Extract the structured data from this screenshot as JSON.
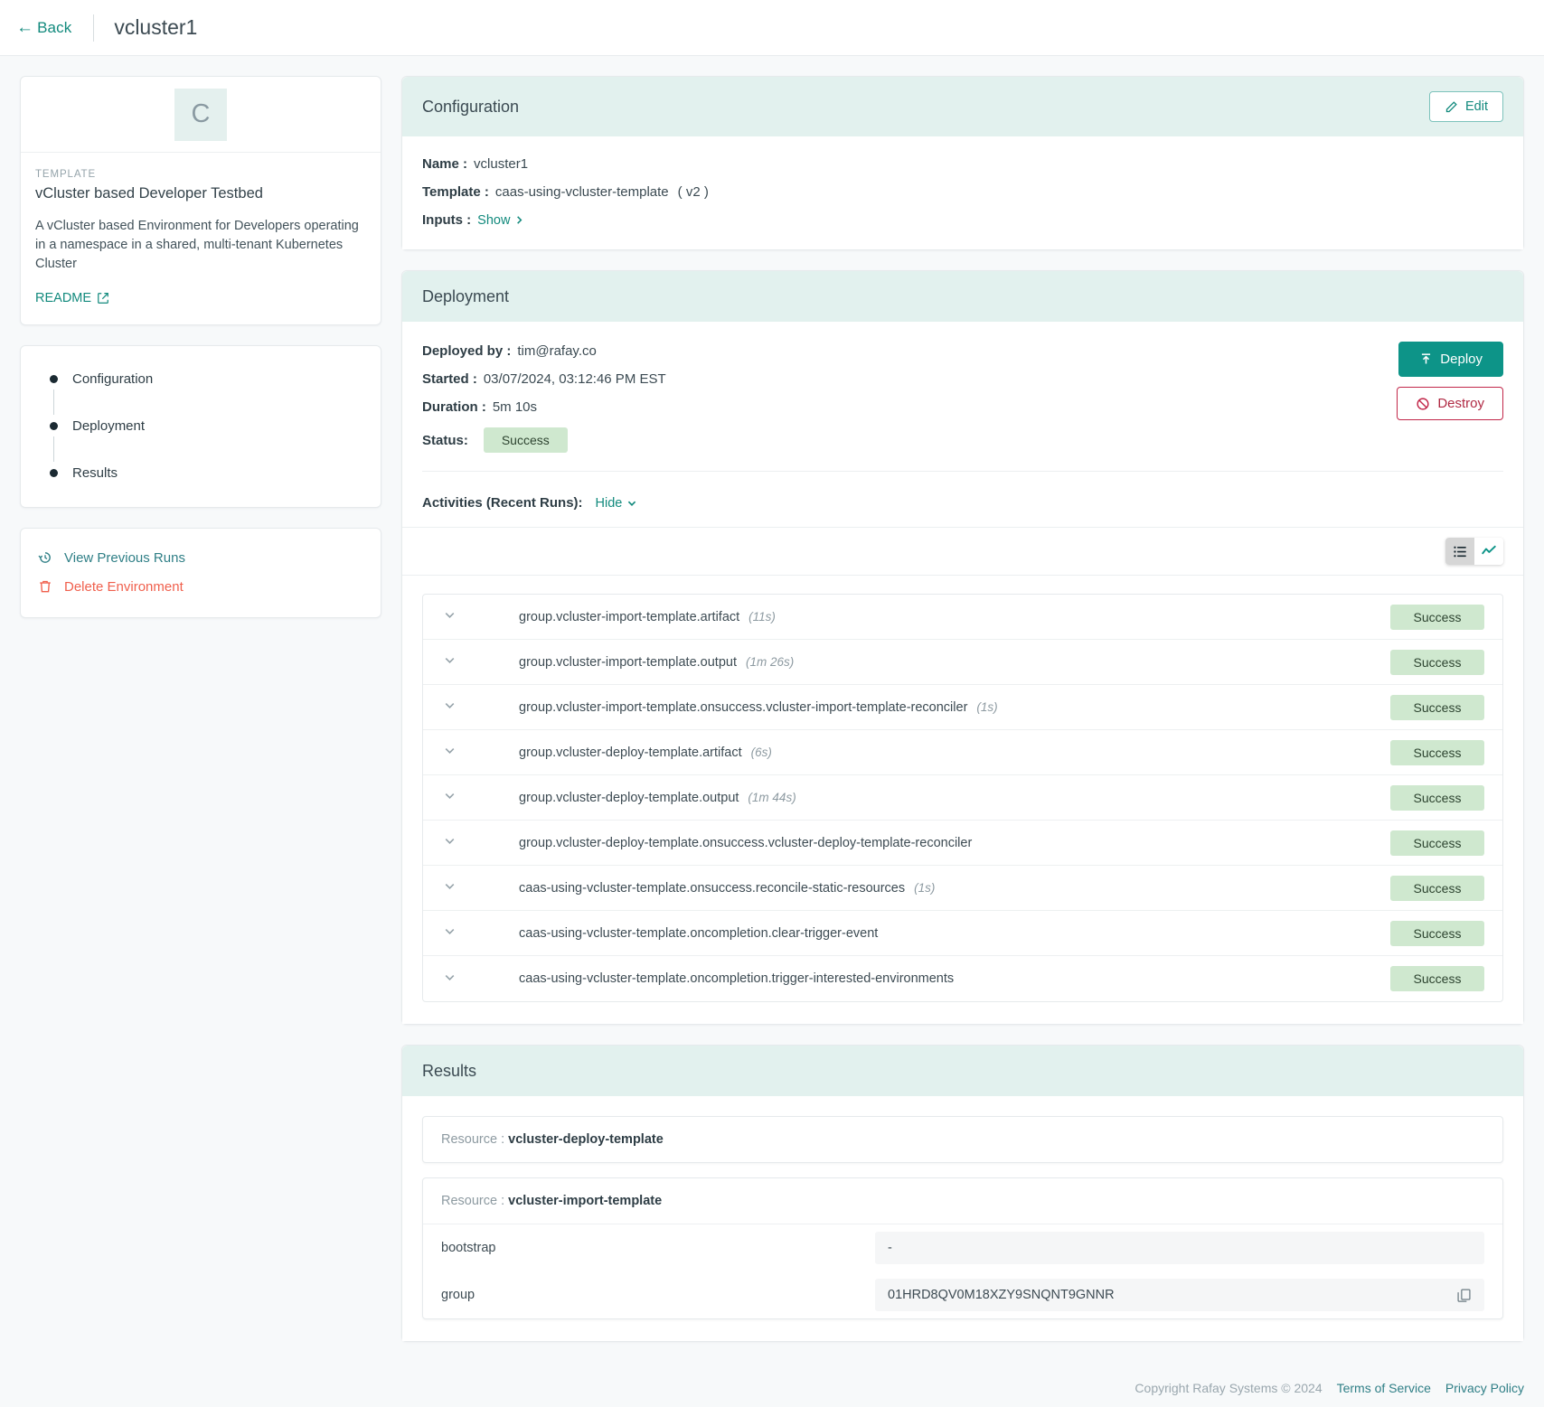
{
  "topbar": {
    "back_label": "Back",
    "back_icon": "arrow-left-icon",
    "title": "vcluster1"
  },
  "template_card": {
    "avatar_letter": "C",
    "kicker": "TEMPLATE",
    "name": "vCluster based Developer Testbed",
    "description": "A vCluster based Environment for Developers operating in a namespace in a shared, multi-tenant Kubernetes Cluster",
    "readme_label": "README",
    "readme_icon": "external-link-icon"
  },
  "steps": [
    {
      "label": "Configuration"
    },
    {
      "label": "Deployment"
    },
    {
      "label": "Results"
    }
  ],
  "sidebar_actions": [
    {
      "label": "View Previous Runs",
      "icon": "history-icon",
      "kind": "primary"
    },
    {
      "label": "Delete Environment",
      "icon": "trash-icon",
      "kind": "danger"
    }
  ],
  "configuration": {
    "title": "Configuration",
    "edit_label": "Edit",
    "edit_icon": "pencil-icon",
    "name_key": "Name :",
    "name_value": "vcluster1",
    "template_key": "Template :",
    "template_value": "caas-using-vcluster-template",
    "template_version": "( v2 )",
    "inputs_key": "Inputs :",
    "inputs_link": "Show",
    "inputs_chevron": "chevron-right-icon"
  },
  "deployment": {
    "title": "Deployment",
    "deployed_by_key": "Deployed by :",
    "deployed_by_value": "tim@rafay.co",
    "started_key": "Started :",
    "started_value": "03/07/2024, 03:12:46 PM EST",
    "duration_key": "Duration :",
    "duration_value": "5m 10s",
    "status_key": "Status:",
    "status_value": "Success",
    "deploy_label": "Deploy",
    "deploy_icon": "upload-icon",
    "destroy_label": "Destroy",
    "destroy_icon": "ban-icon",
    "activities_label": "Activities (Recent Runs):",
    "activities_toggle_label": "Hide",
    "activities_toggle_icon": "chevron-down-icon",
    "view_list_icon": "list-view-icon",
    "view_chart_icon": "chart-view-icon",
    "active_view": "list"
  },
  "activities": [
    {
      "name": "group.vcluster-import-template.artifact",
      "duration": "(11s)",
      "status": "Success"
    },
    {
      "name": "group.vcluster-import-template.output",
      "duration": "(1m 26s)",
      "status": "Success"
    },
    {
      "name": "group.vcluster-import-template.onsuccess.vcluster-import-template-reconciler",
      "duration": "(1s)",
      "status": "Success"
    },
    {
      "name": "group.vcluster-deploy-template.artifact",
      "duration": "(6s)",
      "status": "Success"
    },
    {
      "name": "group.vcluster-deploy-template.output",
      "duration": "(1m 44s)",
      "status": "Success"
    },
    {
      "name": "group.vcluster-deploy-template.onsuccess.vcluster-deploy-template-reconciler",
      "duration": "",
      "status": "Success"
    },
    {
      "name": "caas-using-vcluster-template.onsuccess.reconcile-static-resources",
      "duration": "(1s)",
      "status": "Success"
    },
    {
      "name": "caas-using-vcluster-template.oncompletion.clear-trigger-event",
      "duration": "",
      "status": "Success"
    },
    {
      "name": "caas-using-vcluster-template.oncompletion.trigger-interested-environments",
      "duration": "",
      "status": "Success"
    }
  ],
  "results": {
    "title": "Results",
    "resource_key": "Resource :",
    "resources": [
      {
        "name": "vcluster-deploy-template",
        "rows": []
      },
      {
        "name": "vcluster-import-template",
        "rows": [
          {
            "key": "bootstrap",
            "value": "-",
            "copyable": false
          },
          {
            "key": "group",
            "value": "01HRD8QV0M18XZY9SNQNT9GNNR",
            "copyable": true
          }
        ]
      }
    ],
    "copy_icon": "copy-icon"
  },
  "footer": {
    "copyright": "Copyright Rafay Systems © 2024",
    "terms": "Terms of Service",
    "privacy": "Privacy Policy"
  },
  "colors": {
    "accent": "#128a7d",
    "deploy": "#0d9488",
    "danger": "#f0604d",
    "destroy": "#b02a44",
    "panel_head": "#e2f1ee",
    "success_bg": "#cfe8cf",
    "page_bg": "#f7f9fa"
  }
}
